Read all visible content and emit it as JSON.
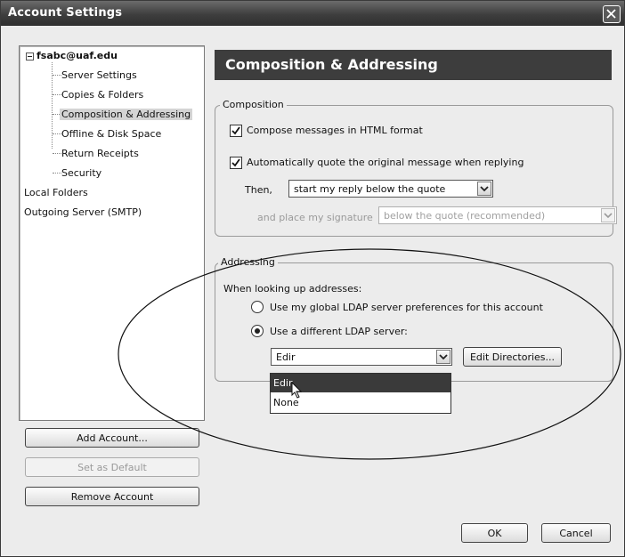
{
  "window": {
    "title": "Account Settings"
  },
  "tree": {
    "account": "fsabc@uaf.edu",
    "children": [
      "Server Settings",
      "Copies & Folders",
      "Composition & Addressing",
      "Offline & Disk Space",
      "Return Receipts",
      "Security"
    ],
    "local_folders": "Local Folders",
    "outgoing": "Outgoing Server (SMTP)"
  },
  "buttons": {
    "add_account": "Add Account...",
    "set_default": "Set as Default",
    "remove_account": "Remove Account",
    "ok": "OK",
    "cancel": "Cancel",
    "edit_directories": "Edit Directories..."
  },
  "panel": {
    "title": "Composition & Addressing"
  },
  "composition": {
    "legend": "Composition",
    "html_label": "Compose messages in HTML format",
    "html_checked": true,
    "quote_label": "Automatically quote the original message when replying",
    "quote_checked": true,
    "then_label": "Then,",
    "then_value": "start my reply below the quote",
    "signature_label": "and place my signature",
    "signature_value": "below the quote (recommended)"
  },
  "addressing": {
    "legend": "Addressing",
    "intro": "When looking up addresses:",
    "opt_global": "Use my global LDAP server preferences for this account",
    "opt_different": "Use a different LDAP server:",
    "selected_option": "different",
    "ldap_value": "Edir",
    "dropdown_options": [
      "Edir",
      "None"
    ],
    "highlighted_option": "Edir"
  }
}
